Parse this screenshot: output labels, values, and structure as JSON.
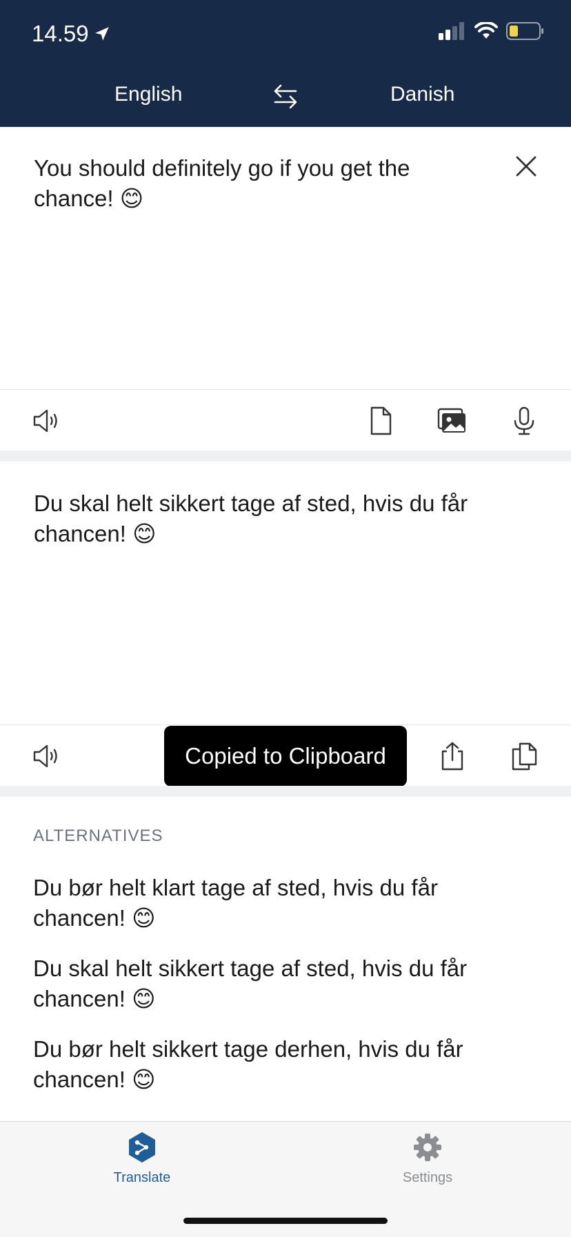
{
  "status_bar": {
    "time": "14.59"
  },
  "header": {
    "source_language": "English",
    "target_language": "Danish"
  },
  "source": {
    "text": "You should definitely go if you get the chance! 😊"
  },
  "target": {
    "text": "Du skal helt sikkert tage af sted, hvis du får chancen! 😊"
  },
  "toast": {
    "message": "Copied to Clipboard"
  },
  "alternatives": {
    "heading": "ALTERNATIVES",
    "items": [
      "Du bør helt klart tage af sted, hvis du får chancen! 😊",
      "Du skal helt sikkert tage af sted, hvis du får chancen! 😊",
      "Du bør helt sikkert tage derhen, hvis du får chancen! 😊"
    ]
  },
  "tabs": [
    {
      "label": "Translate",
      "icon": "deepl-logo-icon",
      "active": true
    },
    {
      "label": "Settings",
      "icon": "gear-icon",
      "active": false
    }
  ],
  "colors": {
    "header_bg": "#172a47",
    "active_tab": "#1f5d99",
    "inactive_tab": "#8a8d91",
    "battery_fill": "#f2d44c"
  }
}
